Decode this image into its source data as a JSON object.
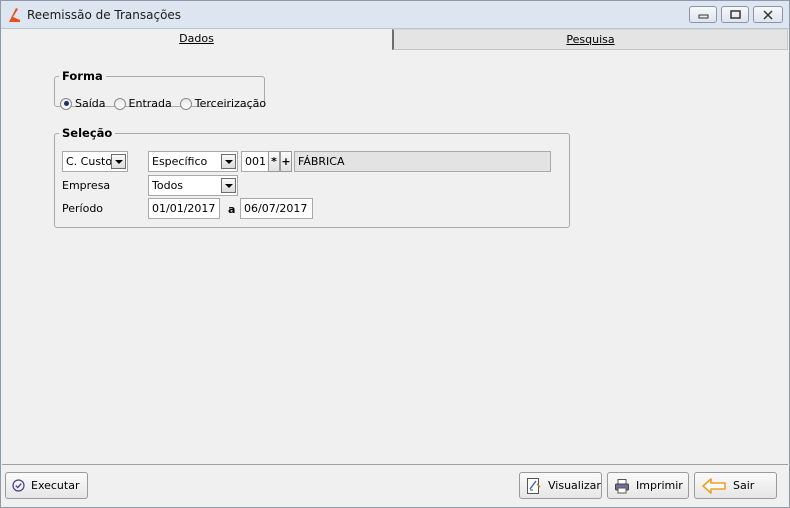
{
  "window": {
    "title": "Reemissão de Transações"
  },
  "tabs": {
    "dados": "Dados",
    "pesquisa": "Pesquisa"
  },
  "forma": {
    "legend": "Forma",
    "options": [
      "Saída",
      "Entrada",
      "Terceirização"
    ],
    "selected": "Saída"
  },
  "selecao": {
    "legend": "Seleção",
    "tipo_value": "C. Custo",
    "modo_value": "Específico",
    "codigo": "001",
    "asterisk": "*",
    "plus": "+",
    "descricao": "FÁBRICA",
    "empresa_label": "Empresa",
    "empresa_value": "Todos",
    "periodo_label": "Período",
    "periodo_inicio": "01/01/2017",
    "periodo_sep": "a",
    "periodo_fim": "06/07/2017"
  },
  "actions": {
    "executar": "Executar",
    "visualizar": "Visualizar",
    "imprimir": "Imprimir",
    "sair": "Sair"
  },
  "colors": {
    "app_icon": "#e8501c",
    "arrow_icon": "#f0a020",
    "radio_selected": "#1f2f6d"
  }
}
